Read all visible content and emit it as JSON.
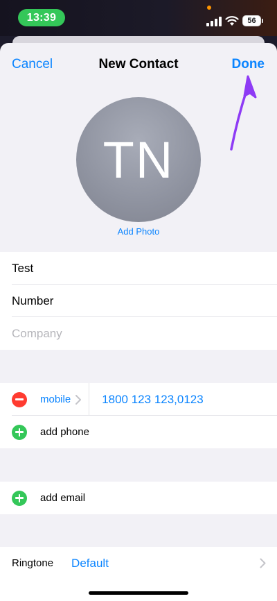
{
  "status_bar": {
    "time": "13:39",
    "battery": "56"
  },
  "nav": {
    "cancel": "Cancel",
    "title": "New Contact",
    "done": "Done"
  },
  "avatar": {
    "initials": "TN",
    "add_photo": "Add Photo"
  },
  "name_fields": {
    "first": "Test",
    "last": "Number",
    "company_placeholder": "Company"
  },
  "phone": {
    "label": "mobile",
    "value": "1800 123 123,0123",
    "add": "add phone"
  },
  "email": {
    "add": "add email"
  },
  "ringtone": {
    "label": "Ringtone",
    "value": "Default"
  },
  "colors": {
    "accent": "#0a84ff",
    "arrow": "#8e3bf5",
    "remove": "#ff3b30",
    "add": "#34c759",
    "time_pill": "#34c759"
  }
}
